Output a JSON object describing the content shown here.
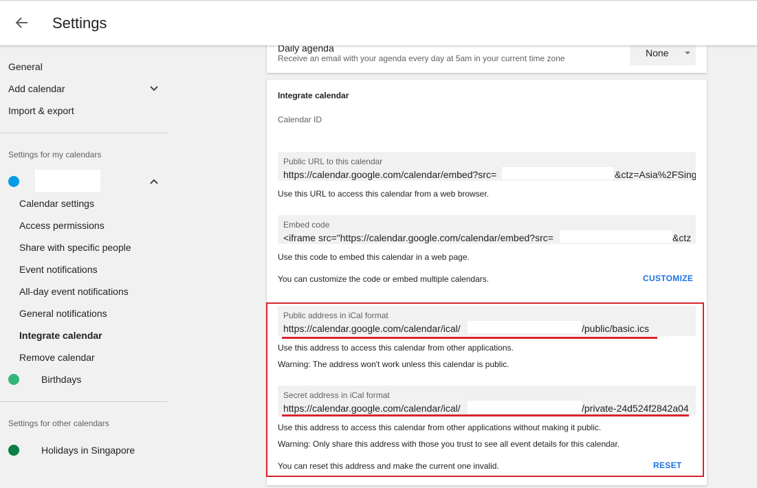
{
  "header": {
    "title": "Settings",
    "back_icon": "arrow-back-icon"
  },
  "sidebar": {
    "top_items": [
      "General",
      "Add calendar",
      "Import & export"
    ],
    "my_calendars_label": "Settings for my calendars",
    "my_calendar": {
      "name": "",
      "color": "#039be5"
    },
    "sub_items": [
      "Calendar settings",
      "Access permissions",
      "Share with specific people",
      "Event notifications",
      "All-day event notifications",
      "General notifications",
      "Integrate calendar",
      "Remove calendar"
    ],
    "active_item": "Integrate calendar",
    "birthdays": {
      "name": "Birthdays",
      "color": "#33b679"
    },
    "other_calendars_label": "Settings for other calendars",
    "holidays": {
      "name": "Holidays in Singapore",
      "color": "#0b8043"
    }
  },
  "daily_agenda": {
    "title": "Daily agenda",
    "description": "Receive an email with your agenda every day at 5am in your current time zone",
    "selected": "None"
  },
  "integrate": {
    "title": "Integrate calendar",
    "calendar_id_label": "Calendar ID",
    "public_url": {
      "label": "Public URL to this calendar",
      "value_start": "https://calendar.google.com/calendar/embed?src=",
      "value_end": "&ctz=Asia%2FSing",
      "help": "Use this URL to access this calendar from a web browser."
    },
    "embed": {
      "label": "Embed code",
      "value_start": "<iframe src=\"https://calendar.google.com/calendar/embed?src=",
      "value_end": "&ctz",
      "help": "Use this code to embed this calendar in a web page.",
      "customize_text": "You can customize the code or embed multiple calendars.",
      "customize_button": "CUSTOMIZE"
    },
    "public_ical": {
      "label": "Public address in iCal format",
      "value_start": "https://calendar.google.com/calendar/ical/",
      "value_end": "/public/basic.ics",
      "help": "Use this address to access this calendar from other applications.",
      "warning": "Warning: The address won't work unless this calendar is public."
    },
    "secret_ical": {
      "label": "Secret address in iCal format",
      "value_start": "https://calendar.google.com/calendar/ical/",
      "value_end": "/private-24d524f2842a04",
      "help": "Use this address to access this calendar from other applications without making it public.",
      "warning": "Warning: Only share this address with those you trust to see all event details for this calendar.",
      "reset_text": "You can reset this address and make the current one invalid.",
      "reset_button": "RESET"
    }
  },
  "colors": {
    "highlight": "#d9232d",
    "accent": "#1a73e8"
  }
}
